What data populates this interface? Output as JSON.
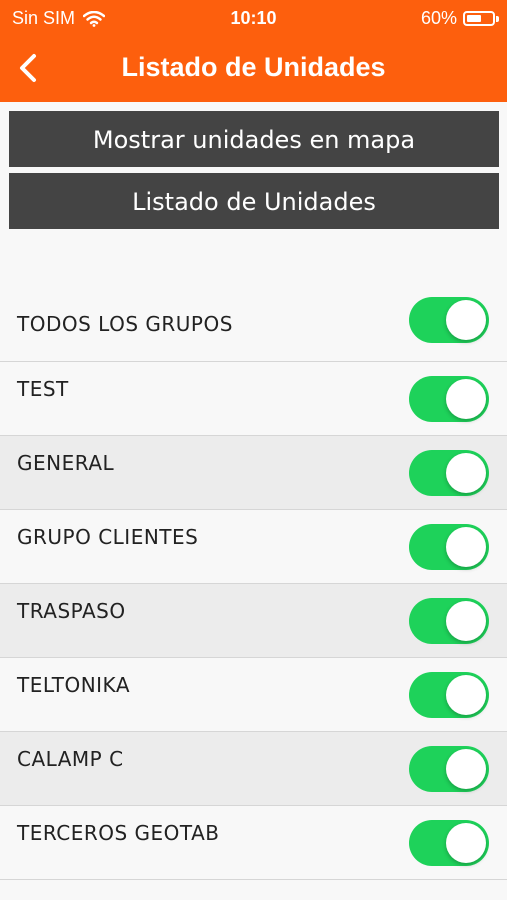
{
  "status_bar": {
    "carrier": "Sin SIM",
    "time": "10:10",
    "battery": "60%",
    "battery_level": 0.6,
    "wifi_icon": "wifi-icon"
  },
  "nav": {
    "title": "Listado de Unidades",
    "back_icon": "chevron-left-icon"
  },
  "buttons": {
    "show_map": "Mostrar unidades en mapa",
    "list_units": "Listado de Unidades"
  },
  "groups": [
    {
      "label": "TODOS LOS GRUPOS",
      "enabled": true
    },
    {
      "label": "TEST",
      "enabled": true
    },
    {
      "label": "GENERAL",
      "enabled": true
    },
    {
      "label": "GRUPO CLIENTES",
      "enabled": true
    },
    {
      "label": "TRASPASO",
      "enabled": true
    },
    {
      "label": "TELTONIKA",
      "enabled": true
    },
    {
      "label": "CALAMP C",
      "enabled": true
    },
    {
      "label": "TERCEROS GEOTAB",
      "enabled": true
    }
  ],
  "colors": {
    "header": "#fd5f0d",
    "button": "#444444",
    "toggle_on": "#1ed25a"
  }
}
